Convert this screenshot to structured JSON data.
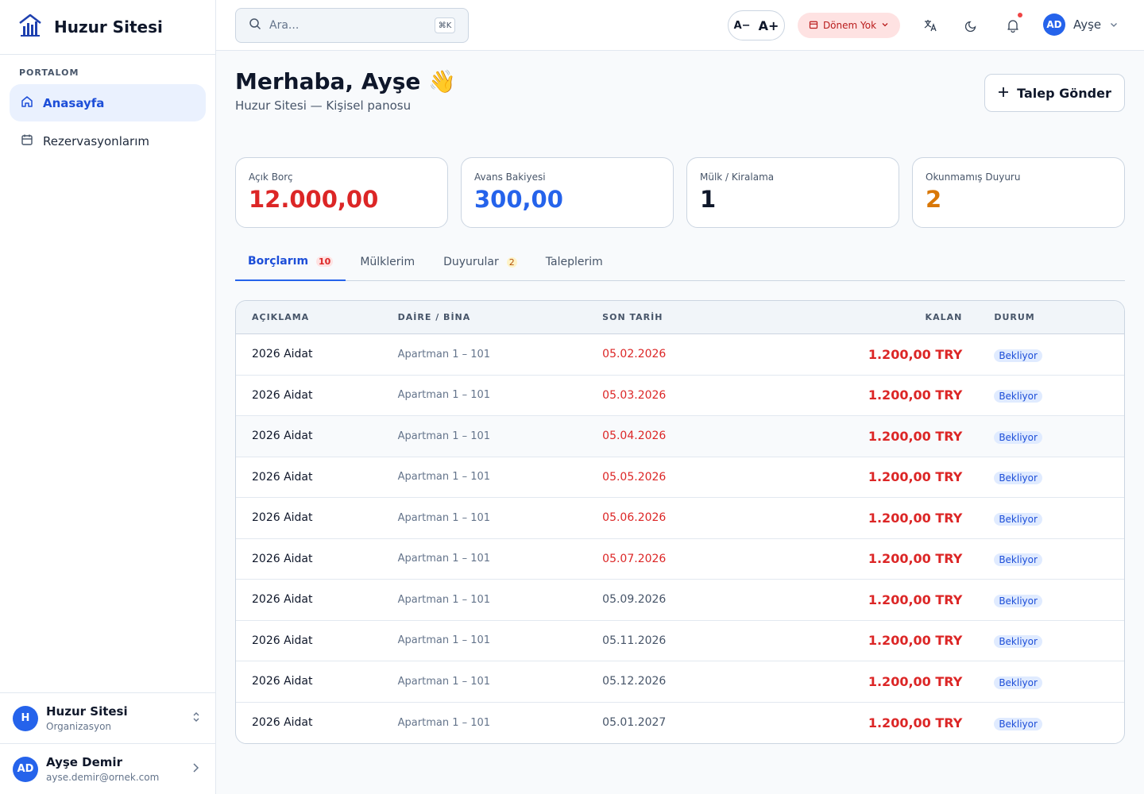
{
  "brand": {
    "name": "Huzur Sitesi"
  },
  "sidebar": {
    "section_title": "PORTALOM",
    "items": [
      {
        "label": "Anasayfa",
        "icon": "home-icon",
        "active": true
      },
      {
        "label": "Rezervasyonlarım",
        "icon": "calendar-icon",
        "active": false
      }
    ],
    "org": {
      "initial": "H",
      "name": "Huzur Sitesi",
      "sub": "Organizasyon"
    },
    "user": {
      "initials": "AD",
      "name": "Ayşe Demir",
      "email": "ayse.demir@ornek.com"
    }
  },
  "topbar": {
    "search_placeholder": "Ara...",
    "search_shortcut": "⌘K",
    "font_decrease": "A−",
    "font_increase": "A+",
    "period_label": "Dönem Yok",
    "profile_initials": "AD",
    "profile_name": "Ayşe"
  },
  "header": {
    "greeting": "Merhaba, Ayşe 👋",
    "subtitle": "Huzur Sitesi — Kişisel panosu",
    "request_button": "Talep Gönder"
  },
  "cards": [
    {
      "label": "Açık Borç",
      "value": "12.000,00",
      "color": "#dc2626"
    },
    {
      "label": "Avans Bakiyesi",
      "value": "300,00",
      "color": "#2563eb"
    },
    {
      "label": "Mülk / Kiralama",
      "value": "1",
      "color": "#0f172a"
    },
    {
      "label": "Okunmamış Duyuru",
      "value": "2",
      "color": "#d97706"
    }
  ],
  "tabs": [
    {
      "label": "Borçlarım",
      "badge": "10",
      "active": true
    },
    {
      "label": "Mülklerim",
      "badge": "",
      "active": false
    },
    {
      "label": "Duyurular",
      "badge": "2",
      "active": false
    },
    {
      "label": "Taleplerim",
      "badge": "",
      "active": false
    }
  ],
  "table": {
    "headers": [
      "AÇIKLAMA",
      "DAİRE / BİNA",
      "SON TARİH",
      "KALAN",
      "DURUM"
    ],
    "rows": [
      {
        "desc": "2026 Aidat",
        "unit": "Apartman 1 – 101",
        "due": "05.02.2026",
        "overdue": true,
        "remaining": "1.200,00 TRY",
        "status": "Bekliyor"
      },
      {
        "desc": "2026 Aidat",
        "unit": "Apartman 1 – 101",
        "due": "05.03.2026",
        "overdue": true,
        "remaining": "1.200,00 TRY",
        "status": "Bekliyor"
      },
      {
        "desc": "2026 Aidat",
        "unit": "Apartman 1 – 101",
        "due": "05.04.2026",
        "overdue": true,
        "remaining": "1.200,00 TRY",
        "status": "Bekliyor"
      },
      {
        "desc": "2026 Aidat",
        "unit": "Apartman 1 – 101",
        "due": "05.05.2026",
        "overdue": true,
        "remaining": "1.200,00 TRY",
        "status": "Bekliyor"
      },
      {
        "desc": "2026 Aidat",
        "unit": "Apartman 1 – 101",
        "due": "05.06.2026",
        "overdue": true,
        "remaining": "1.200,00 TRY",
        "status": "Bekliyor"
      },
      {
        "desc": "2026 Aidat",
        "unit": "Apartman 1 – 101",
        "due": "05.07.2026",
        "overdue": true,
        "remaining": "1.200,00 TRY",
        "status": "Bekliyor"
      },
      {
        "desc": "2026 Aidat",
        "unit": "Apartman 1 – 101",
        "due": "05.09.2026",
        "overdue": false,
        "remaining": "1.200,00 TRY",
        "status": "Bekliyor"
      },
      {
        "desc": "2026 Aidat",
        "unit": "Apartman 1 – 101",
        "due": "05.11.2026",
        "overdue": false,
        "remaining": "1.200,00 TRY",
        "status": "Bekliyor"
      },
      {
        "desc": "2026 Aidat",
        "unit": "Apartman 1 – 101",
        "due": "05.12.2026",
        "overdue": false,
        "remaining": "1.200,00 TRY",
        "status": "Bekliyor"
      },
      {
        "desc": "2026 Aidat",
        "unit": "Apartman 1 – 101",
        "due": "05.01.2027",
        "overdue": false,
        "remaining": "1.200,00 TRY",
        "status": "Bekliyor"
      }
    ]
  },
  "colors": {
    "accent": "#2563eb",
    "danger": "#dc2626",
    "warning": "#d97706",
    "overdue_date": "#dc2626",
    "normal_date": "#475569"
  }
}
